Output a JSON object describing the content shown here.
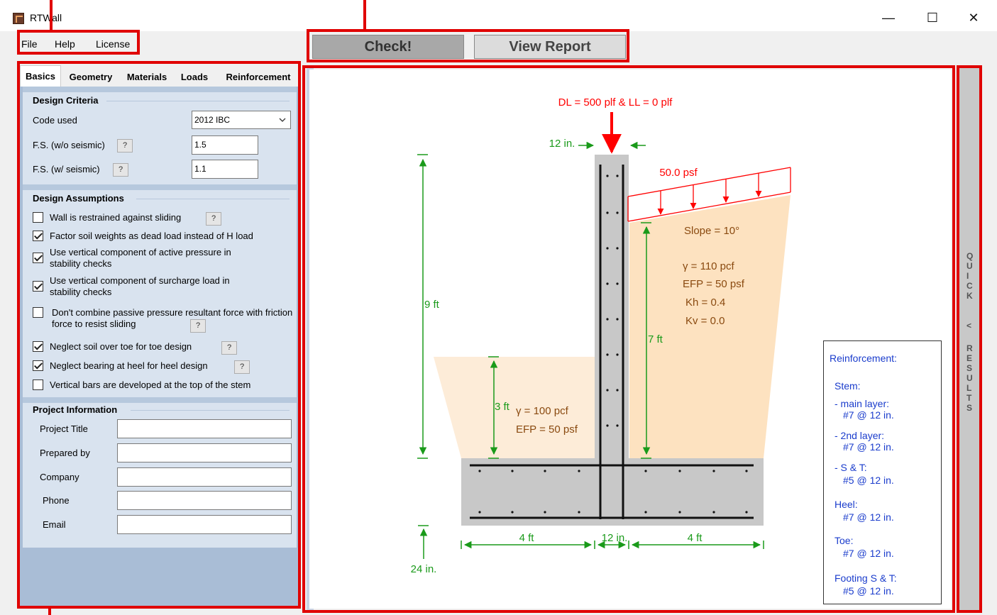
{
  "window": {
    "title": "RTWall",
    "minimize": "—",
    "maximize": "☐",
    "close": "✕",
    "icon": "app-logo-icon"
  },
  "menu": {
    "items": [
      "File",
      "Help",
      "License"
    ]
  },
  "toolbar": {
    "check_label": "Check!",
    "report_label": "View Report"
  },
  "tabs": [
    "Basics",
    "Geometry",
    "Materials",
    "Loads",
    "Reinforcement"
  ],
  "design_criteria": {
    "title": "Design Criteria",
    "code_label": "Code used",
    "code_value": "2012 IBC",
    "fs_wo_label": "F.S. (w/o seismic)",
    "fs_wo_value": "1.5",
    "fs_w_label": "F.S. (w/ seismic)",
    "fs_w_value": "1.1",
    "help_label": "?"
  },
  "design_assumptions": {
    "title": "Design Assumptions",
    "items": [
      {
        "text": "Wall is restrained against sliding",
        "checked": false
      },
      {
        "text": "Factor soil weights as dead load instead of H load",
        "checked": true
      },
      {
        "text": "Use vertical component of active pressure in stability checks",
        "checked": true
      },
      {
        "text": "Use vertical component of surcharge load in stability checks",
        "checked": true
      },
      {
        "text": "Don't combine passive pressure resultant force with friction force to resist sliding",
        "checked": false
      },
      {
        "text": "Neglect soil over toe for toe design",
        "checked": true
      },
      {
        "text": "Neglect bearing at heel for heel design",
        "checked": true
      },
      {
        "text": "Vertical bars are developed at the top of the stem",
        "checked": false
      }
    ]
  },
  "project_info": {
    "title": "Project Information",
    "fields": [
      {
        "label": "Project Title",
        "value": ""
      },
      {
        "label": "Prepared by",
        "value": ""
      },
      {
        "label": "Company",
        "value": ""
      },
      {
        "label": "Phone",
        "value": ""
      },
      {
        "label": "Email",
        "value": ""
      }
    ]
  },
  "drawing": {
    "load_label": "DL = 500 plf & LL = 0 plf",
    "stem_top_dim": "12 in.",
    "surcharge_label": "50.0 psf",
    "slope_label": "Slope = 10°",
    "backfill": [
      "γ = 110 pcf",
      "EFP = 50 psf",
      "Kh = 0.4",
      "Kv = 0.0"
    ],
    "front_soil": [
      "γ = 100 pcf",
      "EFP = 50 psf"
    ],
    "wall_height": "9 ft",
    "retained_height": "7 ft",
    "toe_soil_height": "3 ft",
    "footing_thickness": "24 in.",
    "toe_length": "4 ft",
    "stem_thickness": "12 in.",
    "heel_length": "4 ft",
    "colors": {
      "load": "#ff0000",
      "dims": "#1a9a1a",
      "soil_text": "#8a4a10",
      "concrete": "#c8c8c8",
      "backfill": "#fde2c0",
      "front_soil": "#fdecd8"
    }
  },
  "reinforcement": {
    "title": "Reinforcement:",
    "lines": [
      "Stem:",
      "- main layer:",
      "#7 @ 12 in.",
      "- 2nd layer:",
      "#7 @ 12 in.",
      "- S & T:",
      "#5 @ 12 in.",
      "Heel:",
      "#7 @ 12 in.",
      "Toe:",
      "#7 @ 12 in.",
      "Footing S & T:",
      "#5 @ 12 in."
    ]
  },
  "quick_results": {
    "letters": [
      "Q",
      "U",
      "I",
      "C",
      "K",
      "",
      "<",
      "",
      "R",
      "E",
      "S",
      "U",
      "L",
      "T",
      "S"
    ]
  }
}
